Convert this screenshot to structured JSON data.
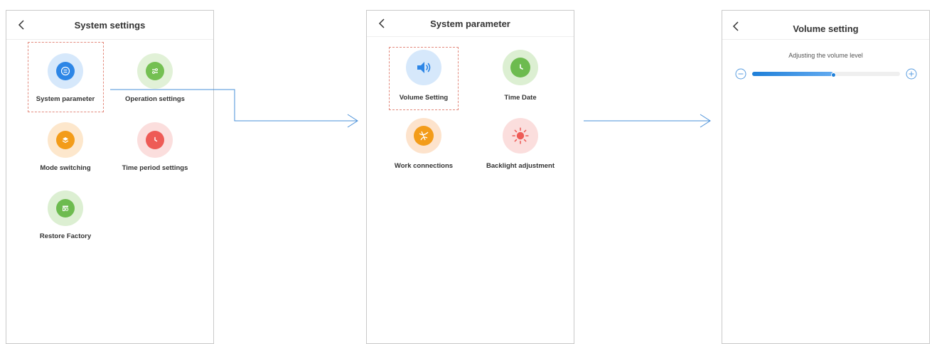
{
  "screens": {
    "system_settings": {
      "title": "System settings",
      "items": [
        {
          "label": "System parameter",
          "icon": "list-icon",
          "color": "#2d86e6",
          "halo": "#d6e8fb"
        },
        {
          "label": "Operation settings",
          "icon": "sliders-icon",
          "color": "#74c052",
          "halo": "#e1f1d7"
        },
        {
          "label": "Mode switching",
          "icon": "layers-icon",
          "color": "#f39c19",
          "halo": "#fde7cc"
        },
        {
          "label": "Time period settings",
          "icon": "clock-icon",
          "color": "#ee5b56",
          "halo": "#fbdedd"
        },
        {
          "label": "Restore Factory",
          "icon": "restore-icon",
          "color": "#6dbb4f",
          "halo": "#dcefd2"
        }
      ]
    },
    "system_parameter": {
      "title": "System parameter",
      "items": [
        {
          "label": "Volume Setting",
          "icon": "speaker-icon",
          "color": "#2d86e6",
          "halo": "#d6e8fb"
        },
        {
          "label": "Time Date",
          "icon": "clock-icon",
          "color": "#6dbb4f",
          "halo": "#dcefd2"
        },
        {
          "label": "Work connections",
          "icon": "connection-icon",
          "color": "#f39c19",
          "halo": "#fde3cc"
        },
        {
          "label": "Backlight adjustment",
          "icon": "sun-icon",
          "color": "#ee5b56",
          "halo": "#fbdedd"
        }
      ]
    },
    "volume_setting": {
      "title": "Volume setting",
      "caption": "Adjusting the volume level",
      "volume_fraction": 0.55
    }
  },
  "colors": {
    "accent": "#2d86e6",
    "highlight_dash": "#e38a7d",
    "arrow": "#4a90d9"
  }
}
